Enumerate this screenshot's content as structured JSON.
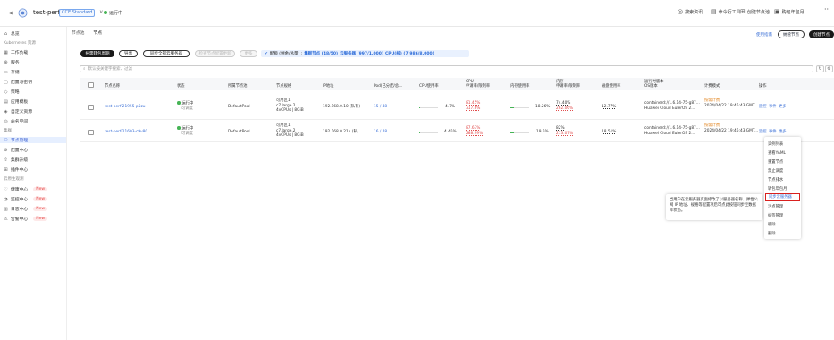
{
  "header": {
    "back": "<",
    "cluster_name": "test-perf",
    "edition_badge": "CCE Standard",
    "caret": "∨",
    "status": "运行中",
    "right_items": [
      "搜索资讯",
      "命令行工具",
      "创建节点池",
      "购包年包月"
    ],
    "more": "···"
  },
  "sidebar": {
    "items": [
      {
        "label": "总览",
        "icon": "home"
      },
      {
        "label": "Kubernetes 资源",
        "group": true
      },
      {
        "label": "工作负载",
        "icon": "workload"
      },
      {
        "label": "服务",
        "icon": "service"
      },
      {
        "label": "存储",
        "icon": "storage"
      },
      {
        "label": "配置与密钥",
        "icon": "config"
      },
      {
        "label": "策略",
        "icon": "policy"
      },
      {
        "label": "应用模板",
        "icon": "template"
      },
      {
        "label": "自定义资源",
        "icon": "crd"
      },
      {
        "label": "命名空间",
        "icon": "namespace"
      },
      {
        "label": "集群",
        "group": true
      },
      {
        "label": "节点管理",
        "icon": "node",
        "active": true
      },
      {
        "label": "配置中心",
        "icon": "settings"
      },
      {
        "label": "集群升级",
        "icon": "upgrade"
      },
      {
        "label": "插件中心",
        "icon": "addon"
      },
      {
        "label": "云原生观测",
        "group": true
      },
      {
        "label": "健康中心",
        "icon": "health",
        "badge": "New"
      },
      {
        "label": "监控中心",
        "icon": "monitor",
        "badge": "New"
      },
      {
        "label": "日志中心",
        "icon": "log",
        "badge": "New"
      },
      {
        "label": "告警中心",
        "icon": "alarm",
        "badge": "New"
      }
    ]
  },
  "tabs": [
    {
      "label": "节点池"
    },
    {
      "label": "节点",
      "active": true
    }
  ],
  "top_right_buttons": [
    "使用指南",
    "纳管节点",
    "创建节点"
  ],
  "toolbar": {
    "buttons": [
      "按需转包周期",
      "导出",
      "同步全部云服务器",
      "检查节点配置更新",
      "更多"
    ],
    "info_prefix": "配额 (剩余/总量) :",
    "info_nodes": "集群节点 (48/50)",
    "info_servers": "云服务器 (997/1,000)",
    "info_cpu": "CPU(核) (7,986/8,000)"
  },
  "search": {
    "placeholder": "默认按关键字搜索、过滤"
  },
  "table": {
    "headers": {
      "name": "节点名称",
      "status": "状态",
      "pool": "所属节点池",
      "spec": "节点规格",
      "ip": "IP地址",
      "pods": "Pod(已分配/总...",
      "cpu_usage": "CPU使用率",
      "cpu_req": "CPU",
      "cpu_req_sub": "申请率/限制率",
      "mem_usage": "内存使用率",
      "mem_req": "内存",
      "mem_req_sub": "申请率/限制率",
      "disk": "磁盘使用率",
      "runtime": "运行时版本",
      "runtime_sub": "OS版本",
      "billing": "计费模式",
      "ops": "操作"
    },
    "rows": [
      {
        "name": "test-perf-21955-p5zu",
        "status": "运行中",
        "status_sub": "可调度",
        "pool": "DefaultPool",
        "spec1": "可用区1",
        "spec2": "c7.large.2",
        "spec3": "4vCPUs | 8GiB",
        "ip": "192.168.0.10 (私有)",
        "pods": "15 / 48",
        "cpu_usage": "4.7%",
        "cpu_usage_val": 0.047,
        "cpu_req": "81.45%",
        "cpu_limit": "317.6%",
        "mem_usage": "18.26%",
        "mem_usage_val": 0.1826,
        "mem_req": "74.40%",
        "mem_limit": "262.06%",
        "disk": "12.77%",
        "runtime": "containerd://1.6.14-75-g87...",
        "os": "Huawei Cloud EulerOS 2...",
        "billing": "按需计费",
        "billing_date": "2024/04/22 19:46:43 GMT...",
        "ops": [
          "监控",
          "事件",
          "更多"
        ]
      },
      {
        "name": "test-perf-21603-c9v80",
        "status": "运行中",
        "status_sub": "可调度",
        "pool": "DefaultPool",
        "spec1": "可用区1",
        "spec2": "c7.large.2",
        "spec3": "4vCPUs | 8GiB",
        "ip": "192.168.0.214 (私...",
        "pods": "16 / 48",
        "cpu_usage": "4.45%",
        "cpu_usage_val": 0.0445,
        "cpu_req": "87.63%",
        "cpu_limit": "288.99%",
        "mem_usage": "19.5%",
        "mem_usage_val": 0.195,
        "mem_req": "82%",
        "mem_limit": "213.07%",
        "disk": "18.51%",
        "runtime": "containerd://1.6.14-75-g87...",
        "os": "Huawei Cloud EulerOS 2...",
        "billing": "按需计费",
        "billing_date": "2024/04/22 19:46:43 GMT...",
        "ops": [
          "监控",
          "事件",
          "更多"
        ]
      }
    ]
  },
  "dropdown": {
    "items": [
      "实例列表",
      "查看YAML",
      "重置节点",
      "禁止调度",
      "节点排水",
      "转包年包月",
      "同步云服务器",
      "污点管理",
      "标签管理",
      "移除",
      "删除"
    ],
    "highlighted": "同步云服务器"
  },
  "tooltip": {
    "text": "当用户在云服务器页面修改了以服务器名称、弹性公网 IP 地址、规格等配置项后可点此按钮同步至数据库状态。"
  },
  "colors": {
    "accent": "#3a6fd6",
    "success": "#46b455",
    "danger": "#e04d4d",
    "highlight_border": "#d9211f"
  }
}
